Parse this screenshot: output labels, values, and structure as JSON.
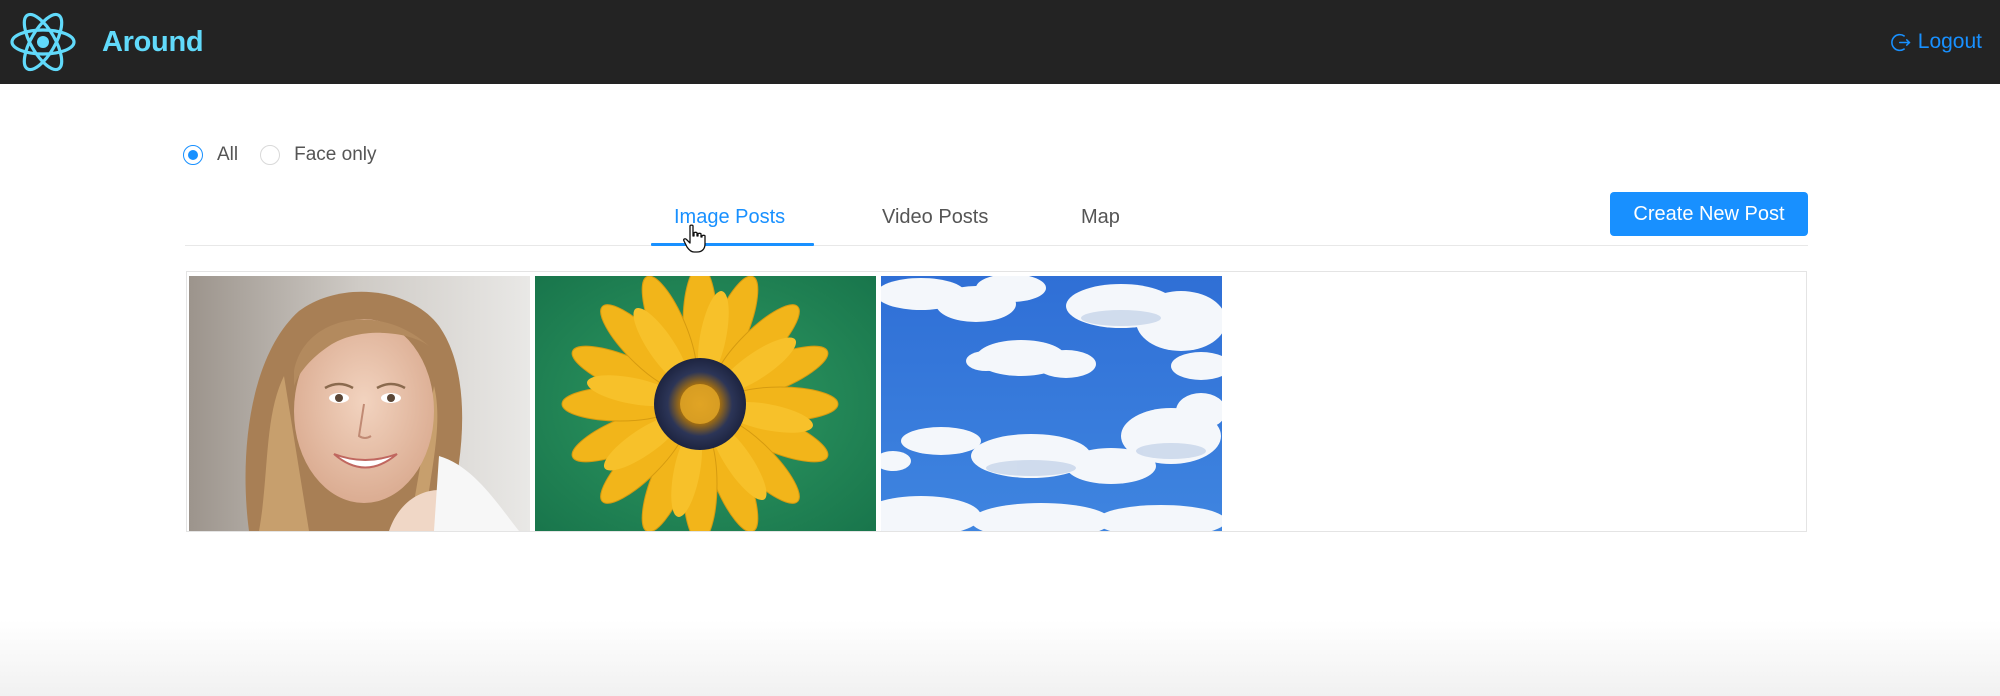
{
  "header": {
    "app_title": "Around",
    "logo_icon": "react-atom-icon",
    "logout_icon": "logout-icon",
    "logout_label": "Logout"
  },
  "filter": {
    "options": [
      {
        "label": "All",
        "checked": true
      },
      {
        "label": "Face only",
        "checked": false
      }
    ]
  },
  "tabs": [
    {
      "label": "Image Posts",
      "active": true
    },
    {
      "label": "Video Posts",
      "active": false
    },
    {
      "label": "Map",
      "active": false
    }
  ],
  "create_button_label": "Create New Post",
  "gallery": {
    "images": [
      {
        "icon": "portrait-photo"
      },
      {
        "icon": "sunflower-photo"
      },
      {
        "icon": "sky-clouds-photo"
      }
    ]
  },
  "colors": {
    "topbar": "#232323",
    "brand": "#61dafb",
    "accent": "#1890ff"
  }
}
